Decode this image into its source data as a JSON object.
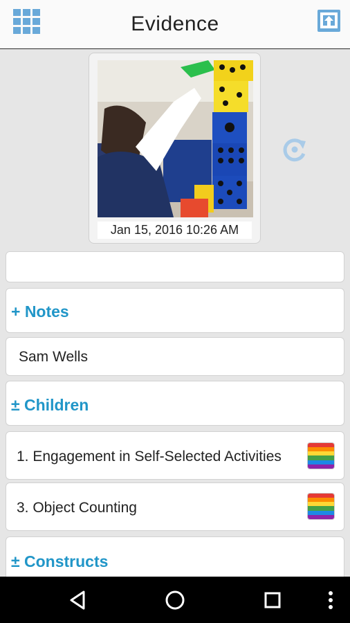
{
  "header": {
    "title": "Evidence"
  },
  "photo": {
    "timestamp": "Jan  15, 2016 10:26 AM"
  },
  "rows": {
    "empty_field": "",
    "notes_section": "+ Notes",
    "note_text": "Sam Wells",
    "children_section": "± Children",
    "child_1": "1. Engagement in Self-Selected Activities",
    "child_2": "3. Object Counting",
    "constructs_section": "± Constructs"
  },
  "icons": {
    "menu": "grid-icon",
    "upload": "upload-icon",
    "refresh": "refresh-icon",
    "rainbow": "rainbow-rating-icon",
    "nav": [
      "back-icon",
      "home-icon",
      "recents-icon",
      "more-icon"
    ]
  },
  "colors": {
    "accent": "#2196c8",
    "icon_blue": "#69a9d9",
    "rainbow": [
      "#e53935",
      "#fb8c00",
      "#fdd835",
      "#43a047",
      "#1e88e5",
      "#8e24aa"
    ]
  }
}
